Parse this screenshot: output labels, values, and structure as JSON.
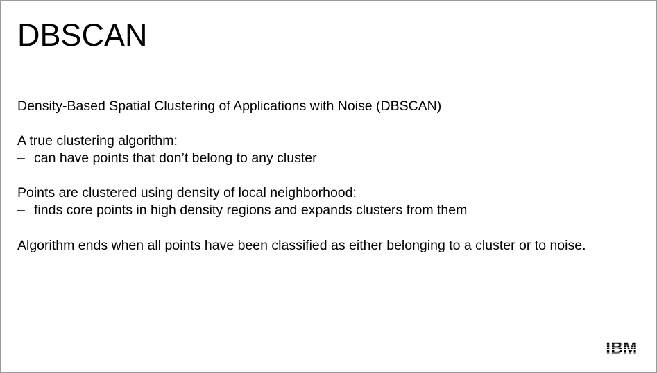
{
  "slide": {
    "title": "DBSCAN",
    "subtitle": "Density-Based Spatial Clustering of Applications with Noise (DBSCAN)",
    "section1": {
      "heading": "A true clustering algorithm:",
      "bullet_marker": "–",
      "bullet": "can have points that don’t belong to any cluster"
    },
    "section2": {
      "heading": "Points are clustered using density of local neighborhood:",
      "bullet_marker": "–",
      "bullet": "finds core points in high density regions and expands clusters from them"
    },
    "conclusion": "Algorithm ends when all points have been classified as either belonging to a cluster or to noise.",
    "logo_text": "IBM",
    "logo_icon": "ibm-logo-icon",
    "colors": {
      "text": "#000000",
      "background": "#ffffff",
      "border": "#9a9a9a"
    }
  }
}
